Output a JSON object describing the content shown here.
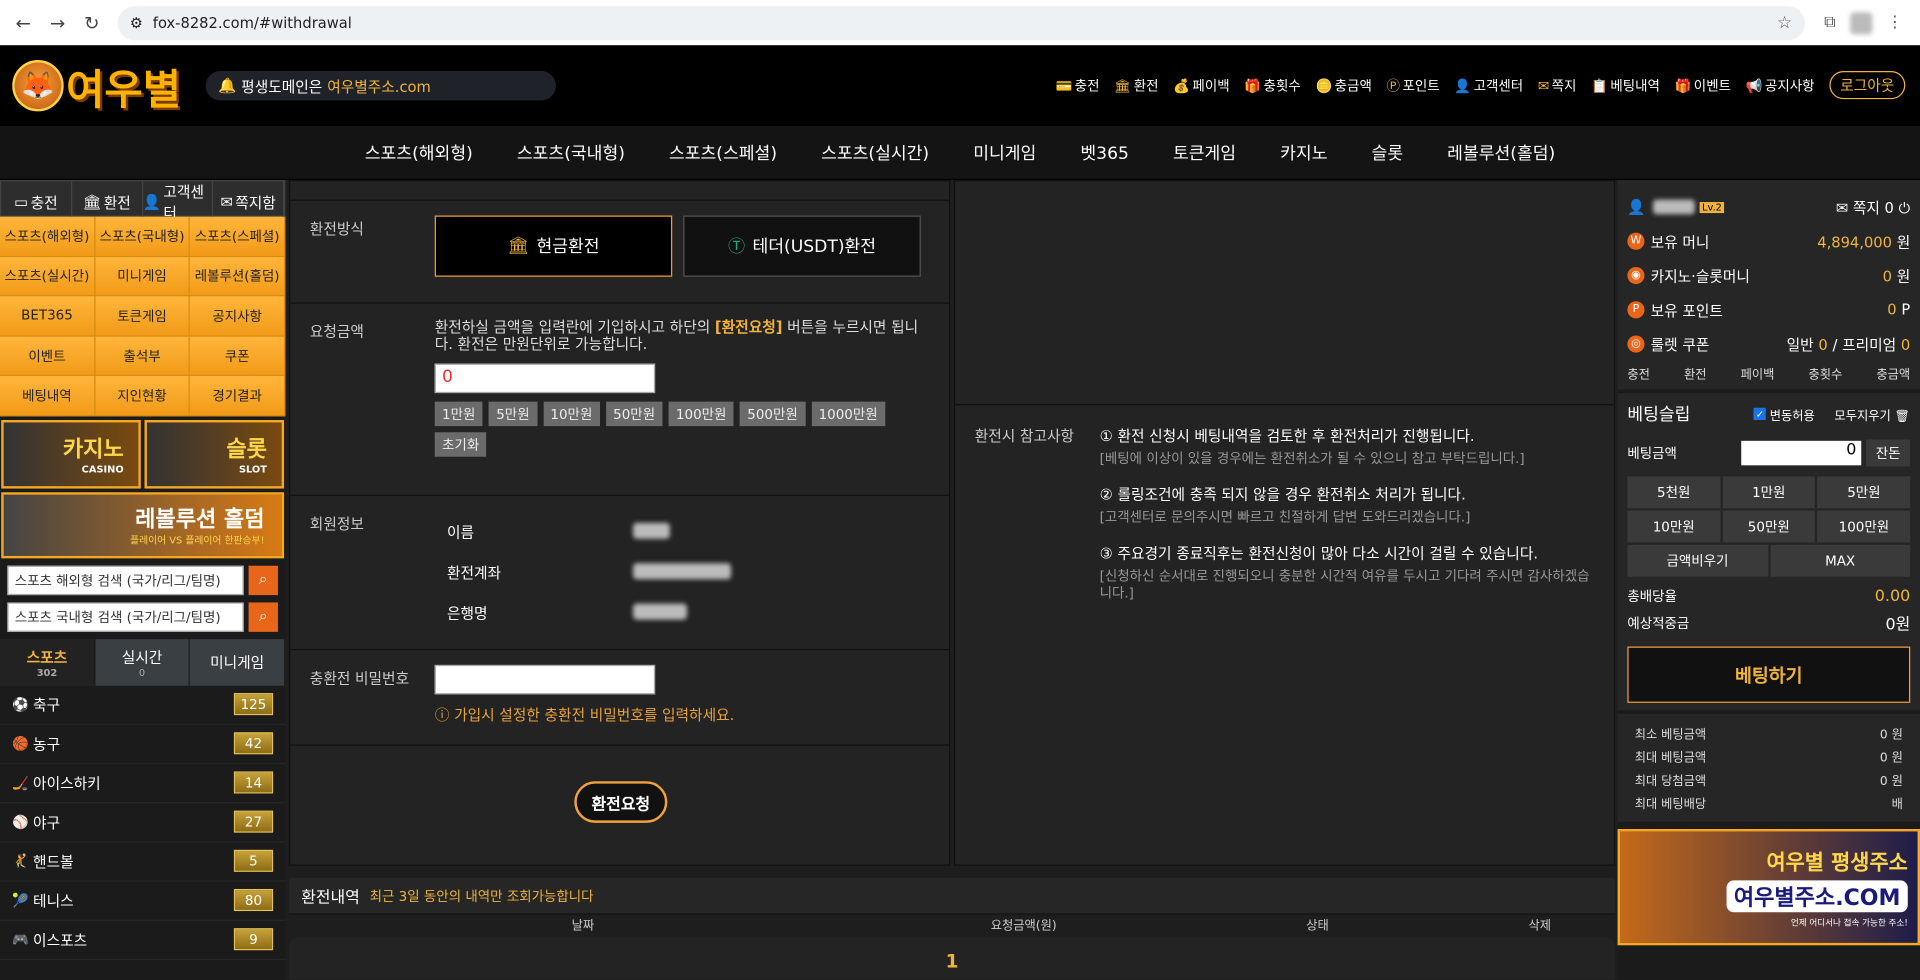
{
  "browser": {
    "url": "fox-8282.com/#withdrawal"
  },
  "header": {
    "logo_text": "여우별",
    "domain_prefix": "평생도메인은",
    "domain_highlight": "여우별주소.com",
    "menu": [
      {
        "icon": "💳",
        "label": "충전"
      },
      {
        "icon": "🏛",
        "label": "환전"
      },
      {
        "icon": "💰",
        "label": "페이백"
      },
      {
        "icon": "🎁",
        "label": "충횟수"
      },
      {
        "icon": "🪙",
        "label": "충금액"
      },
      {
        "icon": "Ⓟ",
        "label": "포인트"
      },
      {
        "icon": "👤",
        "label": "고객센터"
      },
      {
        "icon": "✉",
        "label": "쪽지"
      },
      {
        "icon": "📋",
        "label": "베팅내역"
      },
      {
        "icon": "🎁",
        "label": "이벤트"
      },
      {
        "icon": "📢",
        "label": "공지사항"
      }
    ],
    "logout": "로그아웃"
  },
  "nav": [
    "스포츠(해외형)",
    "스포츠(국내형)",
    "스포츠(스페셜)",
    "스포츠(실시간)",
    "미니게임",
    "벳365",
    "토큰게임",
    "카지노",
    "슬롯",
    "레볼루션(홀덤)"
  ],
  "left": {
    "quick": [
      "충전",
      "환전",
      "고객센터",
      "쪽지함"
    ],
    "grid": [
      "스포츠(해외형)",
      "스포츠(국내형)",
      "스포츠(스페셜)",
      "스포츠(실시간)",
      "미니게임",
      "레볼루션(홀덤)",
      "BET365",
      "토큰게임",
      "공지사항",
      "이벤트",
      "출석부",
      "쿠폰",
      "베팅내역",
      "지인현황",
      "경기결과"
    ],
    "casino": {
      "title": "카지노",
      "sub": "CASINO"
    },
    "slot": {
      "title": "슬롯",
      "sub": "SLOT"
    },
    "holdem": {
      "title": "레볼루션 홀덤",
      "sub": "플레이어 VS 플레이어 한판승부!"
    },
    "search1": "스포츠 해외형 검색 (국가/리그/팀명)",
    "search2": "스포츠 국내형 검색 (국가/리그/팀명)",
    "tabs": [
      {
        "label": "스포츠",
        "count": "302"
      },
      {
        "label": "실시간",
        "count": "0"
      },
      {
        "label": "미니게임",
        "count": ""
      }
    ],
    "sports": [
      {
        "icon": "⚽",
        "name": "축구",
        "count": "125"
      },
      {
        "icon": "🏀",
        "name": "농구",
        "count": "42"
      },
      {
        "icon": "🏒",
        "name": "아이스하키",
        "count": "14"
      },
      {
        "icon": "⚾",
        "name": "야구",
        "count": "27"
      },
      {
        "icon": "🤾",
        "name": "핸드볼",
        "count": "5"
      },
      {
        "icon": "🎾",
        "name": "테니스",
        "count": "80"
      },
      {
        "icon": "🎮",
        "name": "이스포츠",
        "count": "9"
      }
    ]
  },
  "form": {
    "method_label": "환전방식",
    "method_cash": "현금환전",
    "method_usdt": "테더(USDT)환전",
    "amount_label": "요청금액",
    "amount_desc_1": "환전하실 금액을 입력란에 기입하시고 하단의",
    "amount_desc_hl": "[환전요청]",
    "amount_desc_2": "버튼을 누르시면 됩니다. 환전은 만원단위로 가능합니다.",
    "amount_value": "0",
    "chips": [
      "1만원",
      "5만원",
      "10만원",
      "50만원",
      "100만원",
      "500만원",
      "1000만원"
    ],
    "reset": "초기화",
    "member_label": "회원정보",
    "name_label": "이름",
    "account_label": "환전계좌",
    "bank_label": "은행명",
    "pw_label": "충환전 비밀번호",
    "pw_warn": "가입시 설정한 충환전 비밀번호를 입력하세요.",
    "submit": "환전요청"
  },
  "notes": {
    "label": "환전시 참고사항",
    "items": [
      {
        "h": "① 환전 신청시 베팅내역을 검토한 후 환전처리가 진행됩니다.",
        "d": "[베팅에 이상이 있을 경우에는 환전취소가 될 수 있으니 참고 부탁드립니다.]"
      },
      {
        "h": "② 롤링조건에 충족 되지 않을 경우 환전취소 처리가 됩니다.",
        "d": "[고객센터로 문의주시면 빠르고 친절하게 답변 도와드리겠습니다.]"
      },
      {
        "h": "③ 주요경기 종료직후는 환전신청이 많아 다소 시간이 걸릴 수 있습니다.",
        "d": "[신청하신 순서대로 진행되오니 충분한 시간적 여유를 두시고 기다려 주시면 감사하겠습니다.]"
      }
    ]
  },
  "history": {
    "title": "환전내역",
    "sub": "최근 3일 동안의 내역만 조회가능합니다",
    "cols": [
      "날짜",
      "요청금액(원)",
      "상태",
      "삭제"
    ],
    "page": "1"
  },
  "right": {
    "level": "Lv.2",
    "memo": "쪽지 0",
    "money_label": "보유 머니",
    "money": "4,894,000",
    "unit_won": "원",
    "casino_label": "카지노·슬롯머니",
    "casino": "0",
    "point_label": "보유 포인트",
    "point": "0",
    "unit_p": "P",
    "coupon_label": "룰렛 쿠폰",
    "coupon_normal": "일반",
    "coupon_normal_v": "0",
    "coupon_sep": "/",
    "coupon_prem": "프리미엄",
    "coupon_prem_v": "0",
    "links": [
      "충전",
      "환전",
      "페이백",
      "충횟수",
      "충금액"
    ],
    "slip_title": "베팅슬립",
    "change_allow": "변동허용",
    "clear_all": "모두지우기",
    "bet_label": "베팅금액",
    "bet_value": "0",
    "remain": "잔돈",
    "amounts": [
      "5천원",
      "1만원",
      "5만원",
      "10만원",
      "50만원",
      "100만원"
    ],
    "empty": "금액비우기",
    "max": "MAX",
    "total_odds_label": "총배당율",
    "total_odds": "0.00",
    "expected_label": "예상적중금",
    "expected": "0원",
    "bet_btn": "베팅하기",
    "limits": [
      {
        "k": "최소 베팅금액",
        "v": "0 원"
      },
      {
        "k": "최대 베팅금액",
        "v": "0 원"
      },
      {
        "k": "최대 당첨금액",
        "v": "0 원"
      },
      {
        "k": "최대 베팅배당",
        "v": "배"
      }
    ],
    "banner_1": "여우별 평생주소",
    "banner_2": "여우별주소.COM",
    "banner_3": "언제 어디서나 접속 가능한 주소!"
  }
}
